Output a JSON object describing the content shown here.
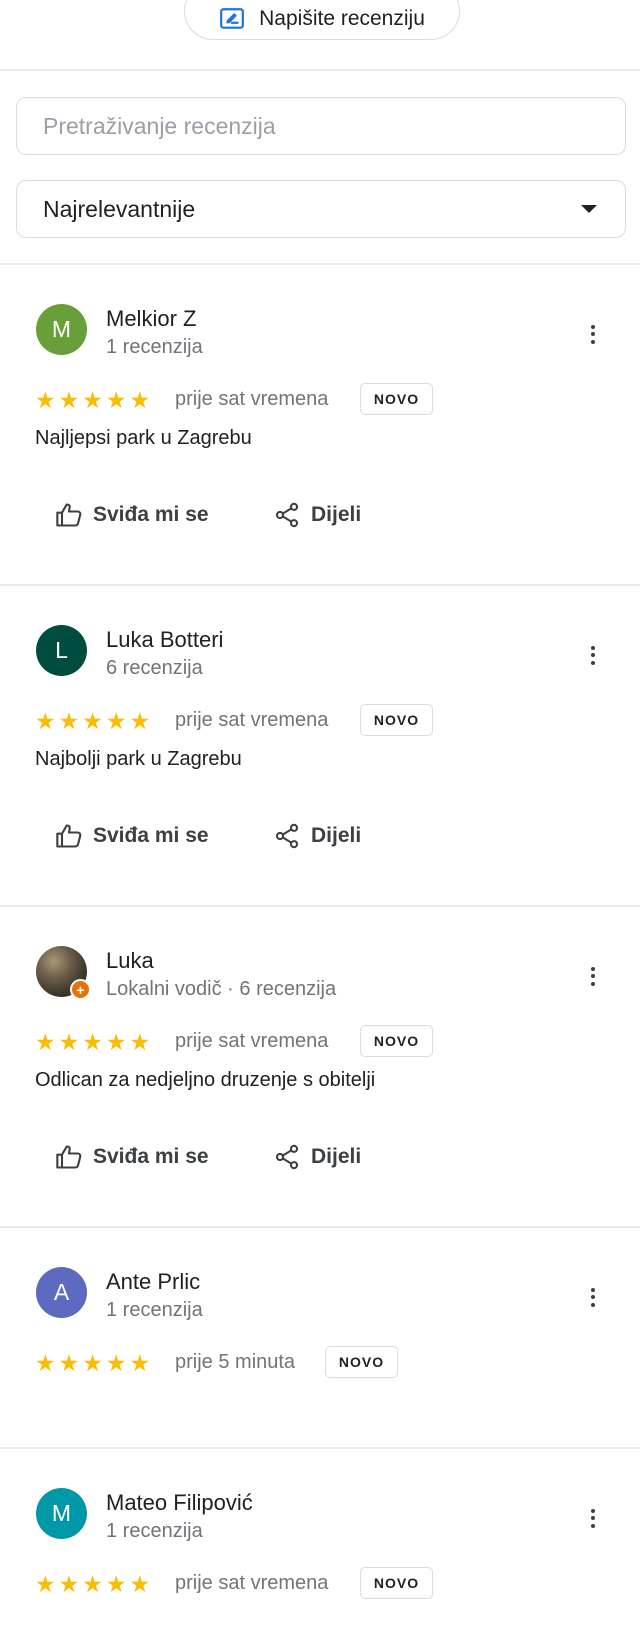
{
  "write_review": {
    "label": "Napišite recenziju"
  },
  "search": {
    "placeholder": "Pretraživanje recenzija"
  },
  "sort": {
    "selected": "Najrelevantnije"
  },
  "actions": {
    "like_label": "Sviđa mi se",
    "share_label": "Dijeli"
  },
  "colors": {
    "star": "#fbbc04",
    "accent": "#1a73e8",
    "local_guide": "#e8710a"
  },
  "reviews": [
    {
      "initial": "M",
      "avatar_color": "#689f38",
      "name": "Melkior Z",
      "meta": "1 recenzija",
      "rating": 5,
      "time": "prije sat vremena",
      "badge": "NOVO",
      "text": "Najljepsi park u Zagrebu"
    },
    {
      "initial": "L",
      "avatar_color": "#004d40",
      "name": "Luka Botteri",
      "meta": "6 recenzija",
      "rating": 5,
      "time": "prije sat vremena",
      "badge": "NOVO",
      "text": "Najbolji park u Zagrebu"
    },
    {
      "initial": "",
      "avatar_color": "#4a4032",
      "name": "Luka",
      "meta": "Lokalni vodič · 6 recenzija",
      "rating": 5,
      "time": "prije sat vremena",
      "badge": "NOVO",
      "text": "Odlican za nedjeljno druzenje s obitelji"
    },
    {
      "initial": "A",
      "avatar_color": "#5c6bc0",
      "name": "Ante Prlic",
      "meta": "1 recenzija",
      "rating": 5,
      "time": "prije 5 minuta",
      "badge": "NOVO",
      "text": ""
    },
    {
      "initial": "M",
      "avatar_color": "#0097a7",
      "name": "Mateo Filipović",
      "meta": "1 recenzija",
      "rating": 5,
      "time": "prije sat vremena",
      "badge": "NOVO",
      "text": ""
    }
  ]
}
